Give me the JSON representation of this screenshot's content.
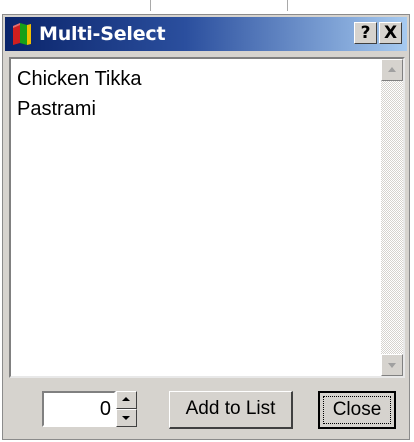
{
  "window": {
    "title": "Multi-Select",
    "help_button_label": "?",
    "close_button_label": "X"
  },
  "list": {
    "items": [
      {
        "label": "Chicken Tikka"
      },
      {
        "label": "Pastrami"
      }
    ]
  },
  "footer": {
    "quantity_value": "0",
    "add_button_label": "Add to List",
    "close_button_label": "Close"
  },
  "icons": {
    "app": "book-icon",
    "scroll_up": "arrow-up-icon",
    "scroll_down": "arrow-down-icon",
    "spin_up": "spin-up-icon",
    "spin_down": "spin-down-icon"
  },
  "colors": {
    "titlebar_start": "#0a246a",
    "titlebar_end": "#a6caf0",
    "window_face": "#d6d3ce",
    "list_background": "#ffffff"
  }
}
